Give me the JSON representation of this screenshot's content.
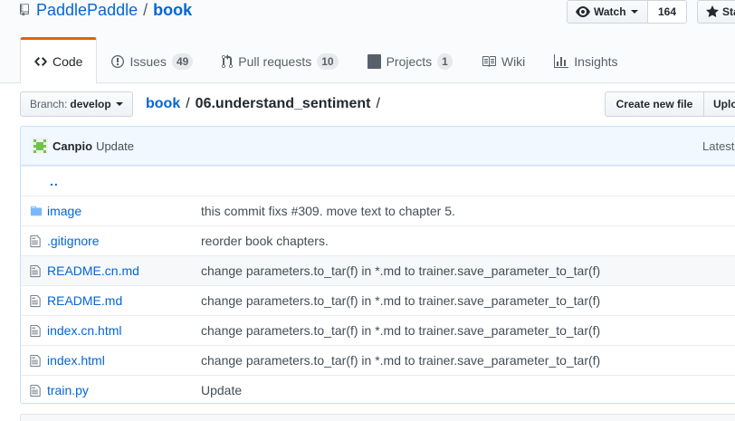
{
  "repo": {
    "owner": "PaddlePaddle",
    "separator": "/",
    "name": "book"
  },
  "actions": {
    "watch_label": "Watch",
    "watch_count": "164",
    "star_label": "Sta"
  },
  "tabs": [
    {
      "label": "Code",
      "icon": "code-icon"
    },
    {
      "label": "Issues",
      "count": "49",
      "icon": "issue-icon"
    },
    {
      "label": "Pull requests",
      "count": "10",
      "icon": "pull-request-icon"
    },
    {
      "label": "Projects",
      "count": "1",
      "icon": "project-icon"
    },
    {
      "label": "Wiki",
      "icon": "book-icon"
    },
    {
      "label": "Insights",
      "icon": "graph-icon"
    }
  ],
  "branch": {
    "label": "Branch:",
    "value": "develop"
  },
  "breadcrumb": {
    "root": "book",
    "sep": "/",
    "current": "06.understand_sentiment",
    "trail": "/"
  },
  "buttons": {
    "create_file": "Create new file",
    "upload": "Uplo"
  },
  "commit": {
    "author": "Canpio",
    "message": "Update",
    "latest": "Latest"
  },
  "parent_dir": "..",
  "files": [
    {
      "name": "image",
      "type": "dir",
      "message": "this commit fixs #309. move text to chapter 5."
    },
    {
      "name": ".gitignore",
      "type": "file",
      "message": "reorder book chapters."
    },
    {
      "name": "README.cn.md",
      "type": "file",
      "message": "change parameters.to_tar(f) in *.md to trainer.save_parameter_to_tar(f)"
    },
    {
      "name": "README.md",
      "type": "file",
      "message": "change parameters.to_tar(f) in *.md to trainer.save_parameter_to_tar(f)"
    },
    {
      "name": "index.cn.html",
      "type": "file",
      "message": "change parameters.to_tar(f) in *.md to trainer.save_parameter_to_tar(f)"
    },
    {
      "name": "index.html",
      "type": "file",
      "message": "change parameters.to_tar(f) in *.md to trainer.save_parameter_to_tar(f)"
    },
    {
      "name": "train.py",
      "type": "file",
      "message": "Update"
    }
  ],
  "colors": {
    "link": "#0366d6",
    "tab_accent": "#e36209",
    "commit_bg": "#f1f8ff",
    "folder": "#79b8ff"
  }
}
